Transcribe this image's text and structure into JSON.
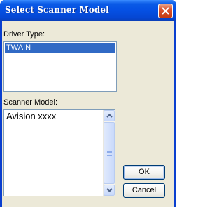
{
  "window": {
    "title": "Select Scanner Model"
  },
  "driver_type": {
    "label": "Driver Type:",
    "items": [
      "TWAIN"
    ],
    "selected": "TWAIN"
  },
  "scanner_model": {
    "label": "Scanner Model:",
    "items": [
      "Avision xxxx"
    ]
  },
  "buttons": {
    "ok_label": "OK",
    "cancel_label": "Cancel"
  },
  "icons": {
    "close": "close-icon",
    "scroll_up": "chevron-up-icon",
    "scroll_down": "chevron-down-icon"
  },
  "colors": {
    "title_bar": "#0550e3",
    "selection": "#316ac5",
    "dialog_face": "#ece9d8",
    "close_button": "#d9532e"
  }
}
